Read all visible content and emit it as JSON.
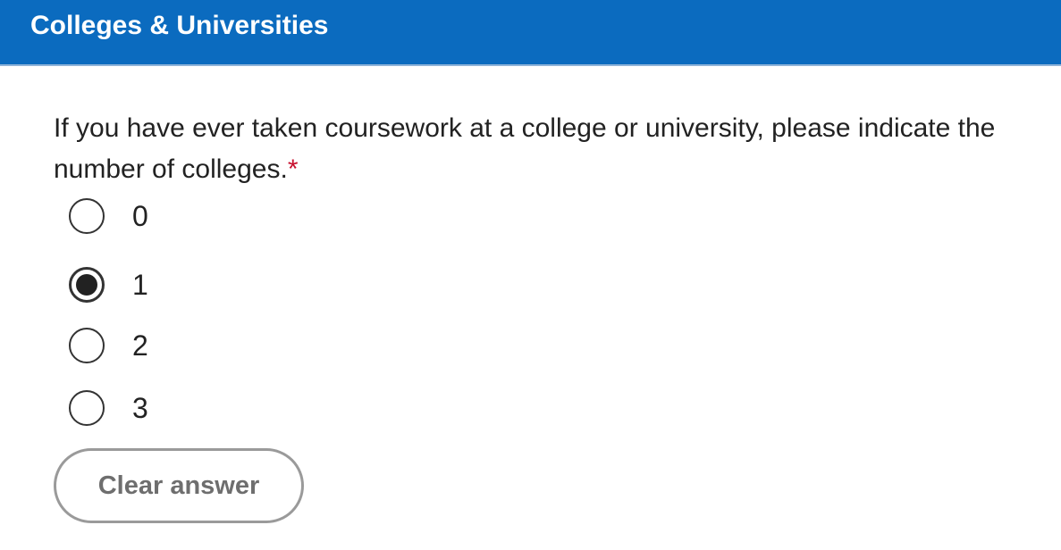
{
  "header": {
    "title": "Colleges & Universities"
  },
  "question": {
    "text": "If you have ever taken coursework at a college or university, please indicate the number of colleges.",
    "required_marker": "*"
  },
  "options": [
    {
      "label": "0",
      "selected": false
    },
    {
      "label": "1",
      "selected": true
    },
    {
      "label": "2",
      "selected": false
    },
    {
      "label": "3",
      "selected": false
    }
  ],
  "clear_button": {
    "label": "Clear answer"
  },
  "colors": {
    "header_bg": "#0b6bbf",
    "required": "#c8102e"
  }
}
